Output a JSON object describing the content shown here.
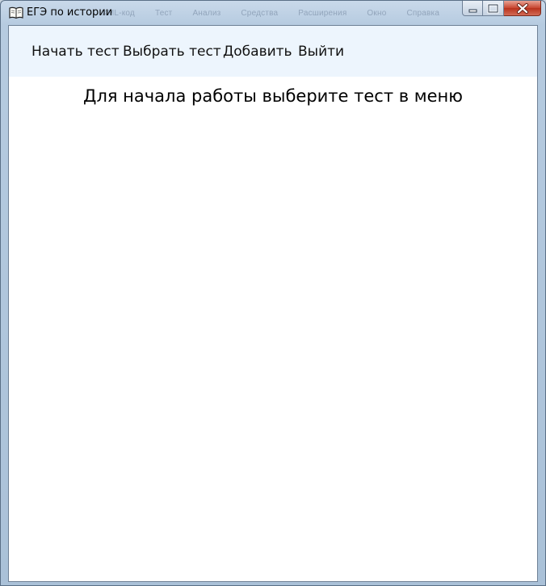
{
  "window": {
    "title": "ЕГЭ по истории",
    "icon": "book-icon",
    "controls": [
      "minimize-icon",
      "maximize-icon",
      "close-icon"
    ],
    "background_app_menu": [
      "XML-код",
      "Тест",
      "Анализ",
      "Средства",
      "Расширения",
      "Окно",
      "Справка"
    ]
  },
  "menu": {
    "items": [
      {
        "label": "Начать тест"
      },
      {
        "label": "Выбрать тест"
      },
      {
        "label": "Добавить"
      },
      {
        "label": "Выйти"
      }
    ],
    "background": "#edf5fd"
  },
  "main": {
    "prompt": "Для начала работы выберите тест в меню"
  },
  "colors": {
    "frame": "#b6cbe0",
    "close_button": "#c7452f",
    "content": "#ffffff"
  }
}
